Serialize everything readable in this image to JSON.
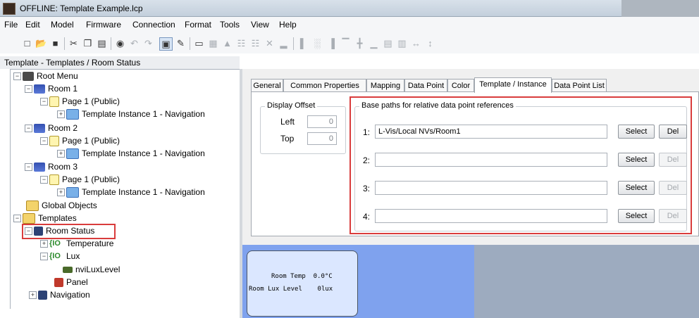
{
  "window": {
    "title": "OFFLINE: Template Example.lcp"
  },
  "menu": [
    "File",
    "Edit",
    "Model",
    "Firmware",
    "Connection",
    "Format",
    "Tools",
    "View",
    "Help"
  ],
  "toolbar": {
    "icons": [
      "new-icon",
      "open-icon",
      "save-icon",
      "cut-icon",
      "copy-icon",
      "paste-icon",
      "camera-icon",
      "undo-icon",
      "redo-icon",
      "window-icon",
      "edit-icon",
      "monitor-icon",
      "align-icon",
      "distribute-icon",
      "grid-icon",
      "crosshair-icon",
      "close-x-icon",
      "underline-icon",
      "align-left-icon",
      "align-center-icon",
      "align-right-icon",
      "align-top-icon",
      "align-middle-icon",
      "align-bottom-icon",
      "space-h-icon",
      "space-v-icon",
      "center-h-icon",
      "center-v-icon"
    ]
  },
  "breadcrumb": "Template - Templates / Room Status",
  "tree": {
    "root": "Root Menu",
    "room1": "Room 1",
    "page1a": "Page 1 (Public)",
    "tpl1": "Template Instance 1 - Navigation",
    "room2": "Room 2",
    "page1b": "Page 1 (Public)",
    "tpl2": "Template Instance 1 - Navigation",
    "room3": "Room 3",
    "page1c": "Page 1 (Public)",
    "tpl3": "Template Instance 1 - Navigation",
    "global": "Global Objects",
    "templates": "Templates",
    "roomstatus": "Room Status",
    "temperature": "Temperature",
    "lux": "Lux",
    "nvilux": "nviLuxLevel",
    "panel": "Panel",
    "navigation": "Navigation",
    "io_glyph": "{IO"
  },
  "tabs": [
    "General",
    "Common Properties",
    "Mapping",
    "Data Point",
    "Color",
    "Template / Instance",
    "Data Point List"
  ],
  "active_tab": "Template / Instance",
  "display_offset": {
    "legend": "Display Offset",
    "left_label": "Left",
    "left_value": "0",
    "top_label": "Top",
    "top_value": "0"
  },
  "base_paths": {
    "legend": "Base paths for relative data point references",
    "rows": [
      {
        "num": "1:",
        "value": "L-Vis/Local NVs/Room1",
        "select": "Select",
        "del": "Del"
      },
      {
        "num": "2:",
        "value": "",
        "select": "Select",
        "del": "Del"
      },
      {
        "num": "3:",
        "value": "",
        "select": "Select",
        "del": "Del"
      },
      {
        "num": "4:",
        "value": "",
        "select": "Select",
        "del": "Del"
      }
    ]
  },
  "preview": {
    "line1": "Room Temp  0.0°C",
    "line2": "Room Lux Level    0lux"
  },
  "colors": {
    "accent_red": "#d93c3c",
    "preview_blue": "#7fa2ee"
  }
}
